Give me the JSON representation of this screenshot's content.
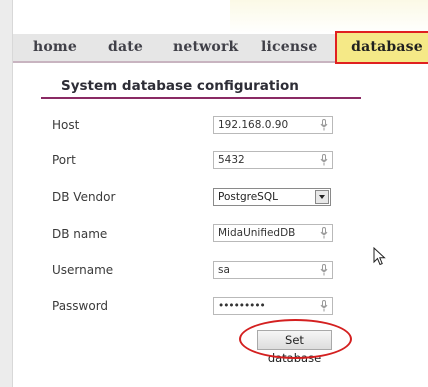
{
  "nav": {
    "home": "home",
    "date": "date",
    "network": "network",
    "license": "license",
    "database": "database"
  },
  "section": {
    "title": "System database configuration"
  },
  "form": {
    "host_label": "Host",
    "host_value": "192.168.0.90",
    "port_label": "Port",
    "port_value": "5432",
    "vendor_label": "DB Vendor",
    "vendor_value": "PostgreSQL",
    "dbname_label": "DB name",
    "dbname_value": "MidaUnifiedDB",
    "username_label": "Username",
    "username_value": "sa",
    "password_label": "Password",
    "password_value": "•••••••••"
  },
  "actions": {
    "set_database": "Set database"
  },
  "colors": {
    "active_tab_bg": "#f5e987",
    "highlight_red": "#e02020",
    "title_rule": "#8a2a64"
  },
  "icons": {
    "field_icon": "microphone-icon",
    "cursor": "mouse-pointer-icon"
  }
}
